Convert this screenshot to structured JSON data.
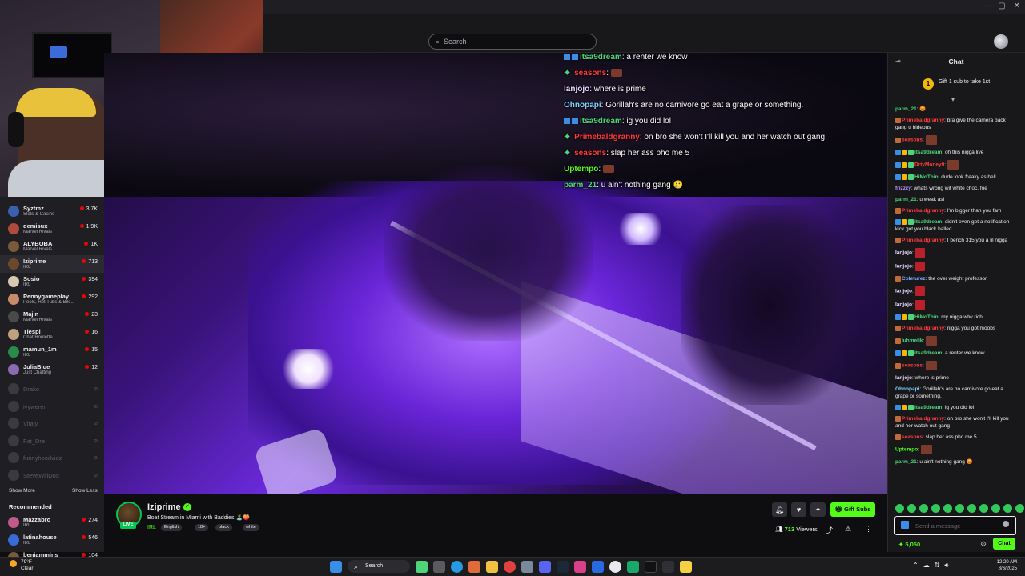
{
  "header": {
    "search_placeholder": "Search"
  },
  "sidebar": {
    "channels": [
      {
        "name": "Syztmz",
        "game": "Slots & Casino",
        "viewers": "3.7K",
        "color": "#3b5fb0"
      },
      {
        "name": "demisux",
        "game": "Marvel Rivals",
        "viewers": "1.9K",
        "color": "#b04a3b"
      },
      {
        "name": "ALYBOBA",
        "game": "Marvel Rivals",
        "viewers": "1K",
        "color": "#7a5a3a"
      },
      {
        "name": "Iziprime",
        "game": "IRL",
        "viewers": "713",
        "color": "#6a4a2a"
      },
      {
        "name": "Sosio",
        "game": "IRL",
        "viewers": "394",
        "color": "#d8c8b0"
      },
      {
        "name": "Pennygameplay",
        "game": "Pools, Hot Tubs & Biki...",
        "viewers": "292",
        "color": "#c88a6a"
      },
      {
        "name": "Majin",
        "game": "Marvel Rivals",
        "viewers": "23",
        "color": "#4a4a4a"
      },
      {
        "name": "Tlespi",
        "game": "Chat Roulette",
        "viewers": "16",
        "color": "#c0a080"
      },
      {
        "name": "mamun_1m",
        "game": "IRL",
        "viewers": "15",
        "color": "#2a8a4a"
      },
      {
        "name": "JuliaBlue",
        "game": "Just Chatting",
        "viewers": "12",
        "color": "#8a6ab0"
      }
    ],
    "offline": [
      {
        "name": "Drako",
        "status": "⊘"
      },
      {
        "name": "ivyweren",
        "status": "⊘"
      },
      {
        "name": "Vitaly",
        "status": "⊘"
      },
      {
        "name": "Fat_Dre",
        "status": "⊘"
      },
      {
        "name": "funnyhoodvidz",
        "status": "⊘"
      },
      {
        "name": "SteveWillDoIt",
        "status": "⊘"
      }
    ],
    "show_more": "Show More",
    "show_less": "Show Less",
    "recommended_title": "Recommended",
    "recommended": [
      {
        "name": "Mazzabro",
        "game": "IRL",
        "viewers": "274",
        "color": "#c05a8a"
      },
      {
        "name": "latinahouse",
        "game": "IRL",
        "viewers": "546",
        "color": "#3a6ad8"
      },
      {
        "name": "benjammins",
        "game": "",
        "viewers": "104",
        "color": "#7a5a3a"
      }
    ]
  },
  "overlay_chat": [
    {
      "user": "itsa9dream",
      "color": "#4fd47a",
      "text": ": a renter we know",
      "badges": 2
    },
    {
      "user": "seasons",
      "color": "#ff3b3b",
      "text": ":",
      "gem": true,
      "emote": true
    },
    {
      "user": "lanjojo",
      "color": "#e8d8ff",
      "text": ": where is prime"
    },
    {
      "user": "Ohnopapi",
      "color": "#7fd4ff",
      "text": ": Gorillah's are no carnivore go eat a grape or something."
    },
    {
      "user": "itsa9dream",
      "color": "#4fd47a",
      "text": ": ig you did lol",
      "badges": 2
    },
    {
      "user": "Primebaldgranny",
      "color": "#ff3b3b",
      "text": ": on bro she won't I'll kill you and her watch out gang",
      "gem": true
    },
    {
      "user": "seasons",
      "color": "#ff3b3b",
      "text": ": slap her ass pho me 5",
      "gem": true
    },
    {
      "user": "Uptempo",
      "color": "#53fc18",
      "text": ":",
      "emote": true
    },
    {
      "user": "parm_21",
      "color": "#4fd47a",
      "text": ": u ain't nothing gang 🥲"
    }
  ],
  "stream": {
    "streamer": "Iziprime",
    "live_label": "LIVE",
    "title": "Boat Stream in Miami with Baddies 🏝️🍑",
    "category": "IRL",
    "tags": [
      "English",
      "18+",
      "black",
      "white"
    ],
    "gift_subs": "Gift Subs",
    "viewers_count": "713",
    "viewers_label": "Viewers"
  },
  "chat": {
    "title": "Chat",
    "gift_banner": "Gift 1 sub to take 1st",
    "messages": [
      {
        "user": "parm_21",
        "color": "#4fd47a",
        "text": ": 😡"
      },
      {
        "user": "Primebaldgranny",
        "color": "#ff3b3b",
        "text": ": bra give the camera back gang u hideous"
      },
      {
        "user": "seasons",
        "color": "#ff3b3b",
        "text": ":",
        "emote": true
      },
      {
        "user": "itsa9dream",
        "color": "#4fd47a",
        "text": ": oh this nigga live"
      },
      {
        "user": "DrtyMoney9",
        "color": "#ff3b3b",
        "text": ":",
        "emote": true
      },
      {
        "user": "HiMoThin",
        "color": "#4fd47a",
        "text": ": dude look freaky as hell"
      },
      {
        "user": "frizzzy",
        "color": "#bf94ff",
        "text": ": whats wrong wit white choc. foe"
      },
      {
        "user": "parm_21",
        "color": "#4fd47a",
        "text": ": u weak asl"
      },
      {
        "user": "Primebaldgranny",
        "color": "#ff3b3b",
        "text": ": I'm bigger than you fam"
      },
      {
        "user": "itsa9dream",
        "color": "#4fd47a",
        "text": ": didn't even get a notification kick got you black balled"
      },
      {
        "user": "Primebaldgranny",
        "color": "#ff3b3b",
        "text": ": I bench 315 you a lil nigga"
      },
      {
        "user": "lanjojo",
        "color": "#e8d8ff",
        "text": ":",
        "emote_red": true
      },
      {
        "user": "lanjojo",
        "color": "#e8d8ff",
        "text": ":",
        "emote_red": true
      },
      {
        "user": "Coleturez",
        "color": "#7fa8ff",
        "text": ": the over weight professor"
      },
      {
        "user": "lanjojo",
        "color": "#e8d8ff",
        "text": ":",
        "emote_red": true
      },
      {
        "user": "lanjojo",
        "color": "#e8d8ff",
        "text": ":",
        "emote_red": true
      },
      {
        "user": "HiMoThin",
        "color": "#4fd47a",
        "text": ": my nigga wtw rich"
      },
      {
        "user": "Primebaldgranny",
        "color": "#ff3b3b",
        "text": ": nigga you got moobs"
      },
      {
        "user": "luhmelik",
        "color": "#4fd47a",
        "text": ":",
        "emote": true
      },
      {
        "user": "itsa9dream",
        "color": "#4fd47a",
        "text": ": a renter we know"
      },
      {
        "user": "seasons",
        "color": "#ff3b3b",
        "text": ":",
        "emote": true
      },
      {
        "user": "lanjojo",
        "color": "#e8d8ff",
        "text": ": where is prime"
      },
      {
        "user": "Ohnopapi",
        "color": "#7fd4ff",
        "text": ": Gorillah's are no carnivore go eat a grape or something."
      },
      {
        "user": "itsa9dream",
        "color": "#4fd47a",
        "text": ": ig you did lol"
      },
      {
        "user": "Primebaldgranny",
        "color": "#ff3b3b",
        "text": ": on bro she won't I'll kill you and her watch out gang"
      },
      {
        "user": "seasons",
        "color": "#ff3b3b",
        "text": ": slap her ass pho me 5"
      },
      {
        "user": "Uptempo",
        "color": "#53fc18",
        "text": ":",
        "emote": true
      },
      {
        "user": "parm_21",
        "color": "#4fd47a",
        "text": ": u ain't nothing gang 😡"
      }
    ],
    "input_placeholder": "Send a message",
    "points": "5,050",
    "send_label": "Chat"
  },
  "taskbar": {
    "weather_temp": "79°F",
    "weather_desc": "Clear",
    "search_label": "Search",
    "time": "12:20 AM",
    "date": "8/6/2025"
  }
}
